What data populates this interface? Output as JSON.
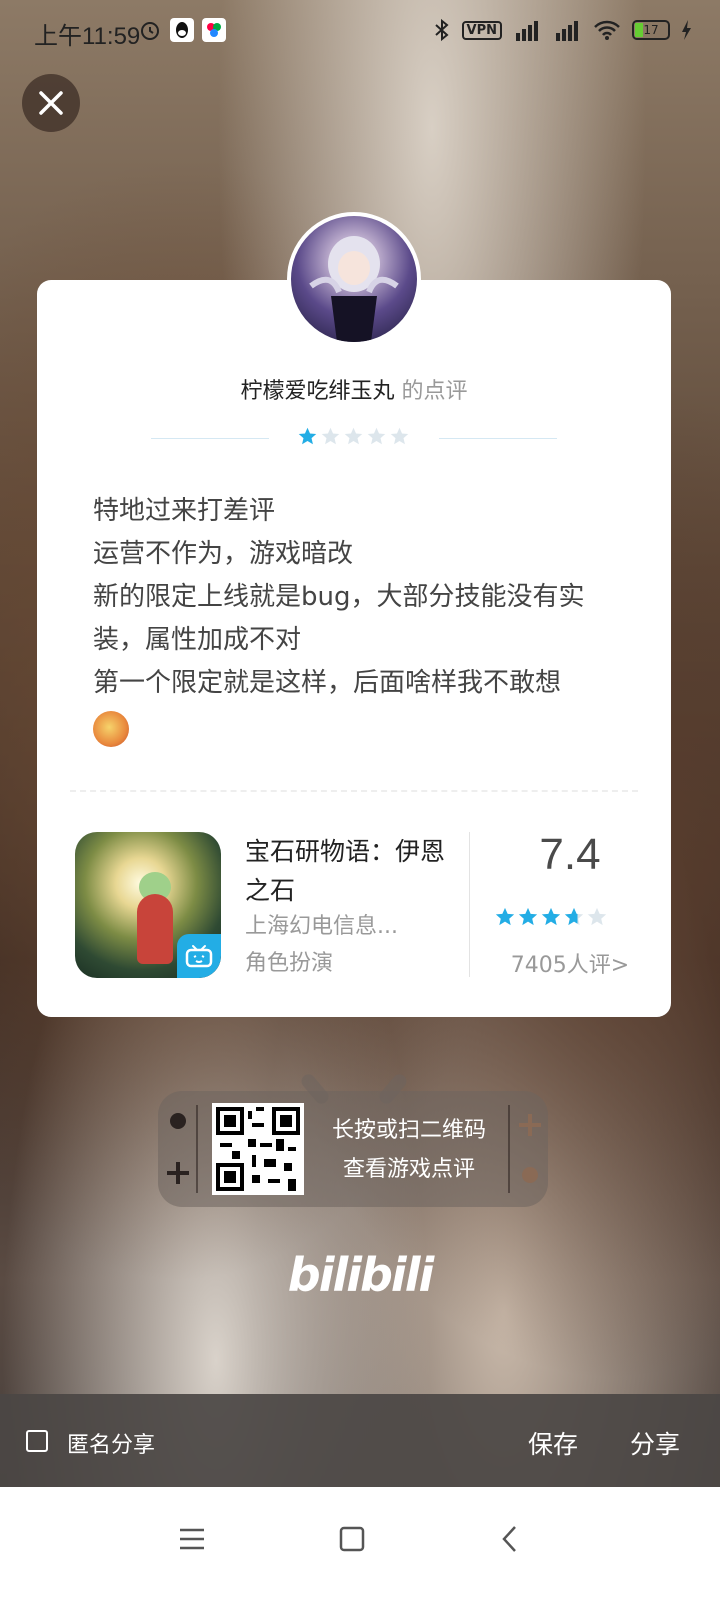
{
  "status_bar": {
    "time": "上午11:59",
    "vpn": "VPN",
    "battery": "17"
  },
  "review": {
    "username": "柠檬爱吃绯玉丸",
    "username_suffix": "的点评",
    "rating": 1,
    "rating_max": 5,
    "lines": [
      "特地过来打差评",
      "运营不作为，游戏暗改",
      "新的限定上线就是bug，大部分技能没有实装，属性加成不对",
      "第一个限定就是这样，后面啥样我不敢想"
    ]
  },
  "game": {
    "name": "宝石研物语：伊恩之石",
    "developer": "上海幻电信息...",
    "category": "角色扮演",
    "score": "7.4",
    "score_stars": 3.7,
    "rating_count": "7405人评>"
  },
  "qr": {
    "line1": "长按或扫二维码",
    "line2": "查看游戏点评"
  },
  "brand": "bilibili",
  "bottom_bar": {
    "anonymous_label": "匿名分享",
    "save_label": "保存",
    "share_label": "分享"
  },
  "colors": {
    "star_active": "#23ade5",
    "star_inactive": "#dde6ec"
  },
  "icons": {
    "close": "close-icon",
    "menu": "menu-icon",
    "home": "home-icon",
    "back": "back-icon"
  }
}
